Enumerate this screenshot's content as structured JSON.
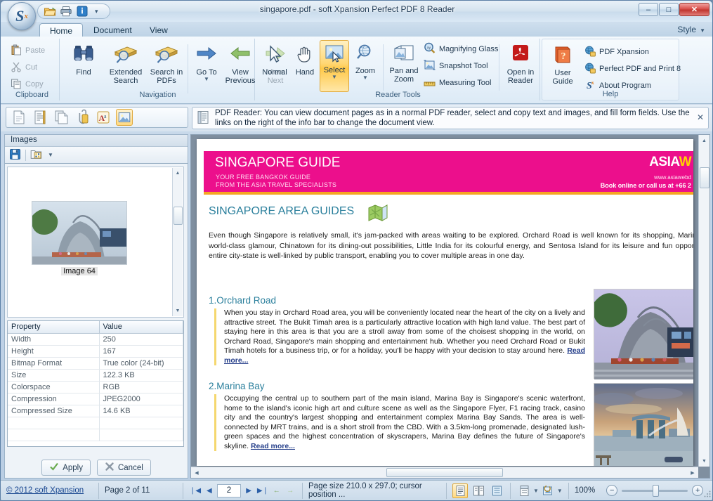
{
  "window": {
    "title": "singapore.pdf - soft Xpansion Perfect PDF 8 Reader",
    "minimize_label": "–",
    "maximize_label": "□",
    "close_label": "✕"
  },
  "quick_access": {
    "items": [
      {
        "name": "open-icon",
        "label": "Open"
      },
      {
        "name": "print-icon",
        "label": "Print"
      },
      {
        "name": "info-icon",
        "label": "Document Info"
      }
    ],
    "more_label": "▾"
  },
  "ribbon": {
    "tabs": [
      {
        "label": "Home",
        "active": true
      },
      {
        "label": "Document",
        "active": false
      },
      {
        "label": "View",
        "active": false
      }
    ],
    "style_menu": "Style",
    "groups": [
      {
        "title": "Clipboard",
        "items": [
          {
            "label": "Paste",
            "icon": "paste-icon",
            "disabled": true
          },
          {
            "label": "Cut",
            "icon": "cut-icon",
            "disabled": true
          },
          {
            "label": "Copy",
            "icon": "copy-icon",
            "disabled": true
          }
        ]
      },
      {
        "title": "Navigation",
        "items": [
          {
            "label": "Find",
            "icon": "binoculars-icon",
            "disabled": false
          },
          {
            "label": "Extended Search",
            "icon": "extended-search-icon",
            "disabled": false
          },
          {
            "label": "Search in PDFs",
            "icon": "search-in-pdfs-icon",
            "disabled": false
          },
          {
            "label": "Go To",
            "icon": "go-to-icon",
            "disabled": false,
            "dropdown": true
          },
          {
            "label": "View Previous",
            "icon": "view-previous-icon",
            "disabled": false
          },
          {
            "label": "View Next",
            "icon": "view-next-icon",
            "disabled": true
          }
        ]
      },
      {
        "title": "Reader Tools",
        "items": [
          {
            "label": "Normal",
            "icon": "cursor-arrow-icon",
            "selected": false
          },
          {
            "label": "Hand",
            "icon": "hand-icon",
            "selected": false
          },
          {
            "label": "Select",
            "icon": "select-image-icon",
            "selected": true,
            "dropdown": true
          },
          {
            "label": "Zoom",
            "icon": "magnifier-icon",
            "selected": false,
            "dropdown": true
          },
          {
            "label": "Pan and Zoom",
            "icon": "pan-and-zoom-icon",
            "selected": false
          },
          {
            "label": "Magnifying Glass",
            "icon": "magnifying-glass-icon",
            "selected": false
          },
          {
            "label": "Snapshot Tool",
            "icon": "snapshot-icon",
            "selected": false
          },
          {
            "label": "Measuring Tool",
            "icon": "ruler-icon",
            "selected": false
          },
          {
            "label": "Open in Reader",
            "icon": "acrobat-icon",
            "selected": false
          }
        ]
      },
      {
        "title": "Help",
        "items": [
          {
            "label": "User Guide",
            "icon": "user-guide-icon"
          },
          {
            "label": "PDF Xpansion",
            "icon": "globe-icon"
          },
          {
            "label": "Perfect PDF and Print 8",
            "icon": "globe-icon"
          },
          {
            "label": "About Program",
            "icon": "softxpansion-icon"
          }
        ]
      }
    ]
  },
  "view_toolbar": {
    "buttons": [
      {
        "name": "page-view-icon",
        "active": false
      },
      {
        "name": "text-view-icon",
        "active": false
      },
      {
        "name": "copy-pages-icon",
        "active": false
      },
      {
        "name": "attachments-icon",
        "active": false
      },
      {
        "name": "fonts-icon",
        "active": false
      },
      {
        "name": "images-view-icon",
        "active": true
      }
    ]
  },
  "info_bar": {
    "icon": "info-document-icon",
    "text": "PDF Reader: You can view document pages as in a normal PDF reader, select and copy text and images, and fill form fields. Use the links on the right of the info bar to change the document view.",
    "close_label": "✕"
  },
  "left_panel": {
    "header": "Images",
    "toolbar": [
      {
        "name": "save-image-icon",
        "label": "Save Image"
      },
      {
        "name": "export-images-icon",
        "label": "Export Images",
        "dropdown": true
      }
    ],
    "thumbnail_caption": "Image 64",
    "properties": {
      "columns": [
        "Property",
        "Value"
      ],
      "rows": [
        [
          "Width",
          "250"
        ],
        [
          "Height",
          "167"
        ],
        [
          "Bitmap Format",
          "True color (24-bit)"
        ],
        [
          "Size",
          "122.3 KB"
        ],
        [
          "Colorspace",
          "RGB"
        ],
        [
          "Compression",
          "JPEG2000"
        ],
        [
          "Compressed Size",
          "14.6 KB"
        ]
      ]
    },
    "apply_label": "Apply",
    "cancel_label": "Cancel"
  },
  "document": {
    "banner": {
      "title": "SINGAPORE GUIDE",
      "subtitle1": "YOUR FREE BANGKOK GUIDE",
      "subtitle2": "FROM THE ASIA TRAVEL SPECIALISTS",
      "logo_main": "ASIA",
      "logo_accent": "W",
      "url": "www.asiawebd",
      "book_text": "Book online or call us at +66 2",
      "bg_color": "#ec0f8c",
      "rule_color": "#f5a623"
    },
    "section_title": "SINGAPORE AREA GUIDES",
    "intro": "Even though Singapore is relatively small, it's jam-packed with areas waiting to be explored. Orchard Road is well known for its shopping, Marina world-class glamour, Chinatown for its dining-out possibilities, Little India for its colourful energy, and Sentosa Island for its leisure and fun opportu entire city-state is well-linked by public transport, enabling you to cover multiple areas in one day.",
    "sections": [
      {
        "heading": "1.Orchard Road",
        "body": "When you stay in Orchard Road area, you will be conveniently located near the heart of the city on a lively and attractive street. The Bukit Timah area is a particularly attractive location with high land value. The best part of staying here in this area is that you are a stroll away from some of the choisest shopping in the world, on Orchard Road, Singapore's main shopping and entertainment hub. Whether you need Orchard Road or Bukit Timah hotels for a business trip, or for a holiday, you'll be happy with your decision to stay around here. ",
        "read_more": "Read more..."
      },
      {
        "heading": "2.Marina Bay",
        "body": "Occupying the central up to southern part of the main island, Marina Bay is Singapore's scenic waterfront, home to the island's iconic high art and culture scene as well as the Singapore Flyer, F1 racing track, casino city and the country's largest shopping and entertainment complex Marina Bay Sands. The area is well-connected by MRT trains, and is a short stroll from the CBD. With a 3.5km-long promenade, designated lush-green spaces and the highest concentration of skyscrapers, Marina Bay defines the future of Singapore's skyline. ",
        "read_more": "Read more..."
      }
    ],
    "photos": [
      {
        "name": "orchard-road-photo"
      },
      {
        "name": "marina-bay-photo"
      }
    ]
  },
  "status_bar": {
    "copyright": "© 2012 soft Xpansion",
    "page_indicator": "Page 2 of 11",
    "nav": {
      "first_label": "❘◀",
      "prev_label": "◀",
      "page_value": "2",
      "next_label": "▶",
      "last_label": "▶❘",
      "back_label": "←",
      "forward_label": "→"
    },
    "page_size": "Page size 210.0 x 297.0; cursor position ...",
    "view_modes": [
      {
        "name": "single-page-icon",
        "active": true
      },
      {
        "name": "facing-pages-icon",
        "active": false
      },
      {
        "name": "continuous-icon",
        "active": false
      }
    ],
    "extra_tools": [
      {
        "name": "page-layout-icon",
        "dropdown": true
      },
      {
        "name": "rotate-view-icon",
        "dropdown": true
      }
    ],
    "zoom_level": "100%",
    "zoom_out_label": "−",
    "zoom_in_label": "+"
  }
}
